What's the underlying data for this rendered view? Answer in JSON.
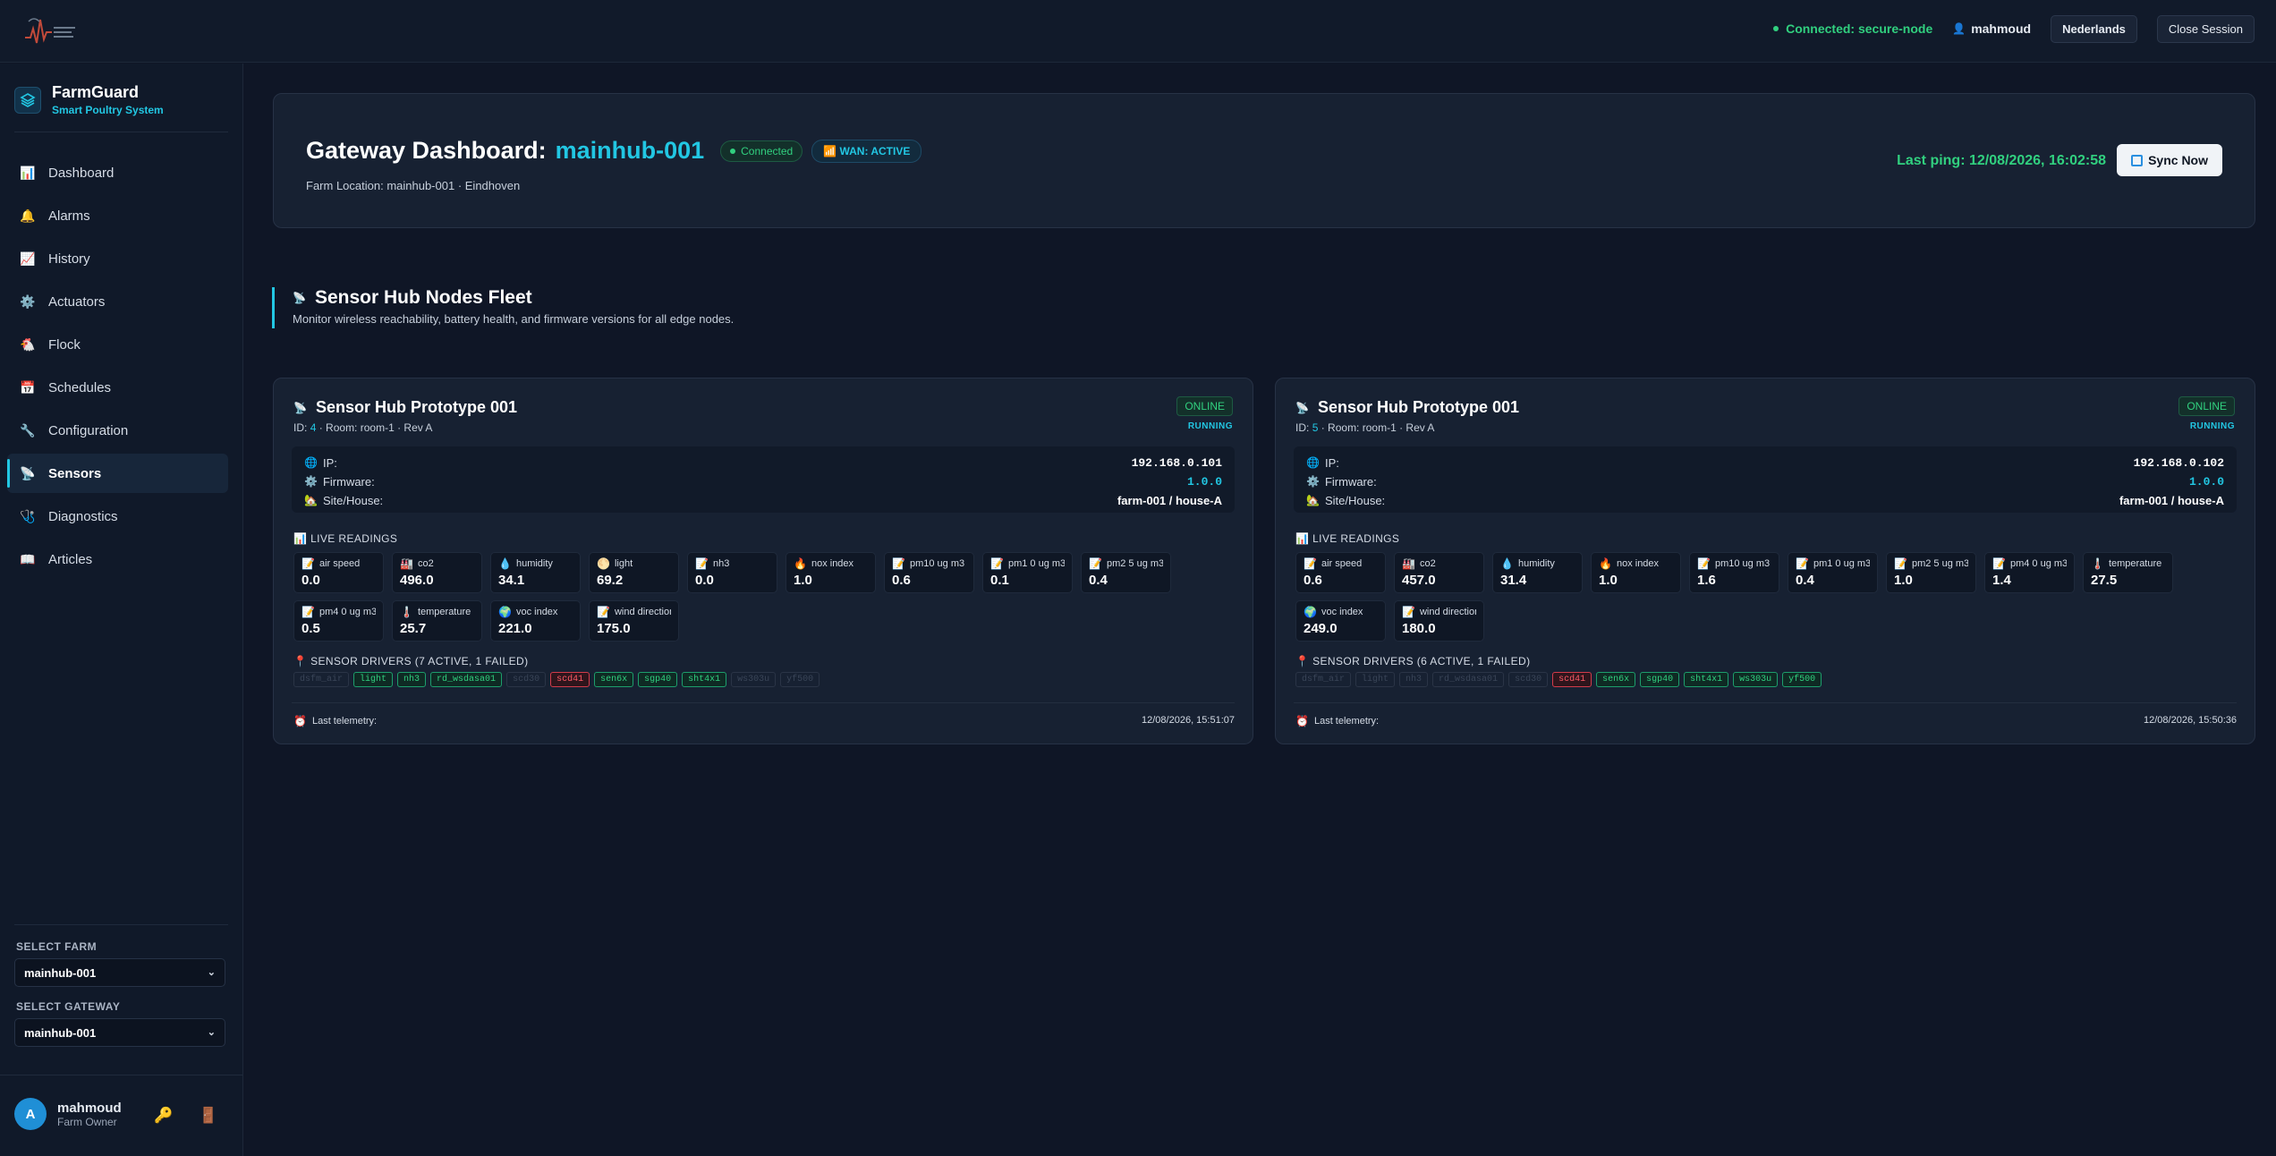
{
  "topbar": {
    "connection": "Connected: secure-node",
    "user": "mahmoud",
    "language": "Nederlands",
    "close": "Close Session"
  },
  "brand": {
    "name": "FarmGuard",
    "subtitle": "Smart Poultry System"
  },
  "sidebar": {
    "items": [
      {
        "label": "Dashboard",
        "icon": "chart-bar-icon"
      },
      {
        "label": "Alarms",
        "icon": "bell-icon"
      },
      {
        "label": "History",
        "icon": "chart-line-icon"
      },
      {
        "label": "Actuators",
        "icon": "gear-icon"
      },
      {
        "label": "Flock",
        "icon": "chicken-icon"
      },
      {
        "label": "Schedules",
        "icon": "calendar-icon"
      },
      {
        "label": "Configuration",
        "icon": "wrench-icon"
      },
      {
        "label": "Sensors",
        "icon": "satellite-icon",
        "active": true
      },
      {
        "label": "Diagnostics",
        "icon": "stethoscope-icon"
      },
      {
        "label": "Articles",
        "icon": "book-icon"
      }
    ],
    "select_farm_label": "SELECT FARM",
    "select_farm_value": "mainhub-001",
    "select_gateway_label": "SELECT GATEWAY",
    "select_gateway_value": "mainhub-001",
    "user": {
      "initial": "A",
      "name": "mahmoud",
      "role": "Farm Owner"
    }
  },
  "header": {
    "title_prefix": "Gateway Dashboard:",
    "gateway": "mainhub-001",
    "status_badge": "Connected",
    "wan_badge": "WAN: ACTIVE",
    "location": "Farm Location: mainhub-001 · Eindhoven",
    "last_ping": "Last ping: 12/08/2026, 16:02:58",
    "sync": "Sync Now"
  },
  "section": {
    "title": "Sensor Hub Nodes Fleet",
    "subtitle": "Monitor wireless reachability, battery health, and firmware versions for all edge nodes."
  },
  "nodes": [
    {
      "title": "Sensor Hub Prototype 001",
      "id_prefix": "ID:",
      "id": "4",
      "meta": "· Room: room-1 · Rev A",
      "status": "ONLINE",
      "state": "RUNNING",
      "ip_label": "IP:",
      "ip": "192.168.0.101",
      "fw_label": "Firmware:",
      "firmware": "1.0.0",
      "site_label": "Site/House:",
      "site": "farm-001 / house-A",
      "live_label": "LIVE READINGS",
      "readings": [
        {
          "name": "air speed",
          "value": "0.0"
        },
        {
          "name": "co2",
          "value": "496.0"
        },
        {
          "name": "humidity",
          "value": "34.1"
        },
        {
          "name": "light",
          "value": "69.2"
        },
        {
          "name": "nh3",
          "value": "0.0"
        },
        {
          "name": "nox index",
          "value": "1.0"
        },
        {
          "name": "pm10 ug m3",
          "value": "0.6"
        },
        {
          "name": "pm1 0 ug m3",
          "value": "0.1"
        },
        {
          "name": "pm2 5 ug m3",
          "value": "0.4"
        },
        {
          "name": "pm4 0 ug m3",
          "value": "0.5"
        },
        {
          "name": "temperature",
          "value": "25.7"
        },
        {
          "name": "voc index",
          "value": "221.0"
        },
        {
          "name": "wind direction",
          "value": "175.0"
        }
      ],
      "drivers_label": "SENSOR DRIVERS (7 ACTIVE, 1 FAILED)",
      "drivers": [
        {
          "name": "dsfm_air",
          "state": "off"
        },
        {
          "name": "light",
          "state": "ok"
        },
        {
          "name": "nh3",
          "state": "ok"
        },
        {
          "name": "rd_wsdasa01",
          "state": "ok"
        },
        {
          "name": "scd30",
          "state": "off"
        },
        {
          "name": "scd41",
          "state": "fail"
        },
        {
          "name": "sen6x",
          "state": "ok"
        },
        {
          "name": "sgp40",
          "state": "ok"
        },
        {
          "name": "sht4x1",
          "state": "ok"
        },
        {
          "name": "ws303u",
          "state": "off"
        },
        {
          "name": "yf500",
          "state": "off"
        }
      ],
      "telemetry_label": "Last telemetry:",
      "telemetry": "12/08/2026, 15:51:07"
    },
    {
      "title": "Sensor Hub Prototype 001",
      "id_prefix": "ID:",
      "id": "5",
      "meta": "· Room: room-1 · Rev A",
      "status": "ONLINE",
      "state": "RUNNING",
      "ip_label": "IP:",
      "ip": "192.168.0.102",
      "fw_label": "Firmware:",
      "firmware": "1.0.0",
      "site_label": "Site/House:",
      "site": "farm-001 / house-A",
      "live_label": "LIVE READINGS",
      "readings": [
        {
          "name": "air speed",
          "value": "0.6"
        },
        {
          "name": "co2",
          "value": "457.0"
        },
        {
          "name": "humidity",
          "value": "31.4"
        },
        {
          "name": "nox index",
          "value": "1.0"
        },
        {
          "name": "pm10 ug m3",
          "value": "1.6"
        },
        {
          "name": "pm1 0 ug m3",
          "value": "0.4"
        },
        {
          "name": "pm2 5 ug m3",
          "value": "1.0"
        },
        {
          "name": "pm4 0 ug m3",
          "value": "1.4"
        },
        {
          "name": "temperature",
          "value": "27.5"
        },
        {
          "name": "voc index",
          "value": "249.0"
        },
        {
          "name": "wind direction",
          "value": "180.0"
        }
      ],
      "drivers_label": "SENSOR DRIVERS (6 ACTIVE, 1 FAILED)",
      "drivers": [
        {
          "name": "dsfm_air",
          "state": "off"
        },
        {
          "name": "light",
          "state": "off"
        },
        {
          "name": "nh3",
          "state": "off"
        },
        {
          "name": "rd_wsdasa01",
          "state": "off"
        },
        {
          "name": "scd30",
          "state": "off"
        },
        {
          "name": "scd41",
          "state": "fail"
        },
        {
          "name": "sen6x",
          "state": "ok"
        },
        {
          "name": "sgp40",
          "state": "ok"
        },
        {
          "name": "sht4x1",
          "state": "ok"
        },
        {
          "name": "ws303u",
          "state": "ok"
        },
        {
          "name": "yf500",
          "state": "ok"
        }
      ],
      "telemetry_label": "Last telemetry:",
      "telemetry": "12/08/2026, 15:50:36"
    }
  ]
}
